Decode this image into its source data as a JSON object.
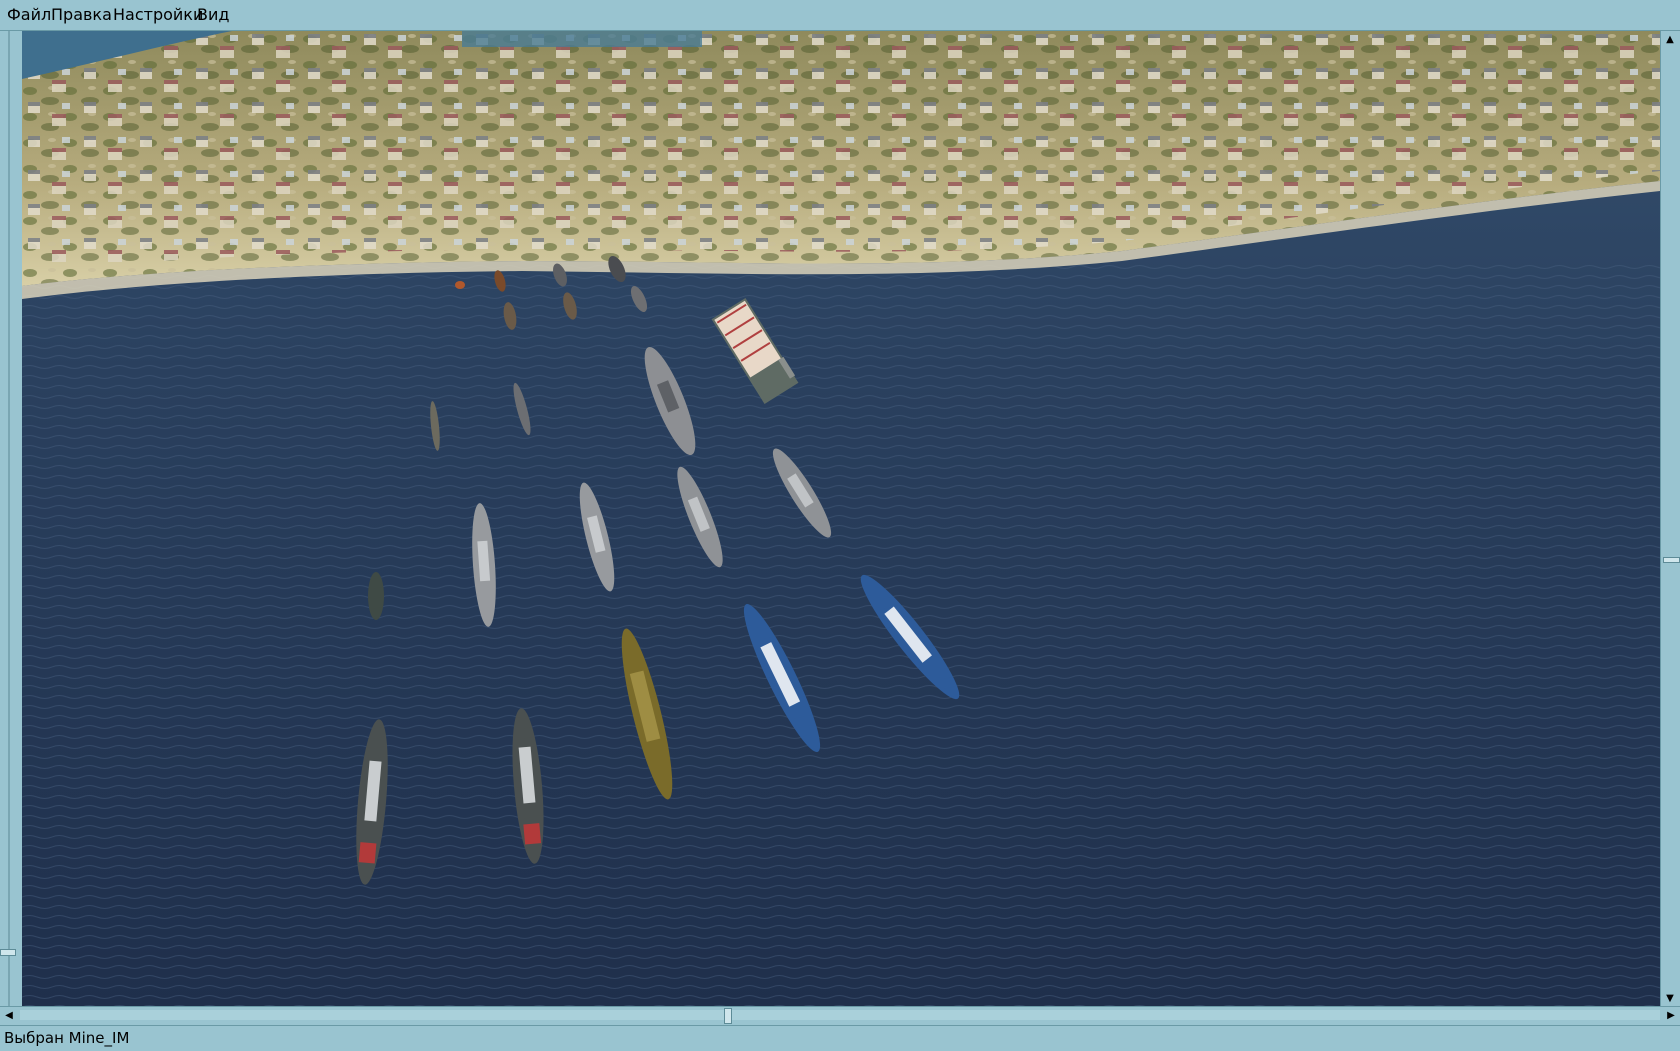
{
  "menu": {
    "file": "Файл",
    "edit": "Правка",
    "settings": "Настройки",
    "view": "Вид"
  },
  "statusbar": {
    "text": "Выбран Mine_IM"
  },
  "icons": {
    "scroll_up": "arrow-up-icon",
    "scroll_down": "arrow-down-icon",
    "scroll_left": "arrow-left-icon",
    "scroll_right": "arrow-right-icon"
  },
  "colors": {
    "chrome": "#99c4d0",
    "sea": "#243552",
    "coast": "#b9ae82",
    "ship_gray": "#8f9297",
    "ship_blue": "#2d5b9a",
    "ship_olive": "#7a6b2a",
    "ship_dark": "#4a5050"
  }
}
